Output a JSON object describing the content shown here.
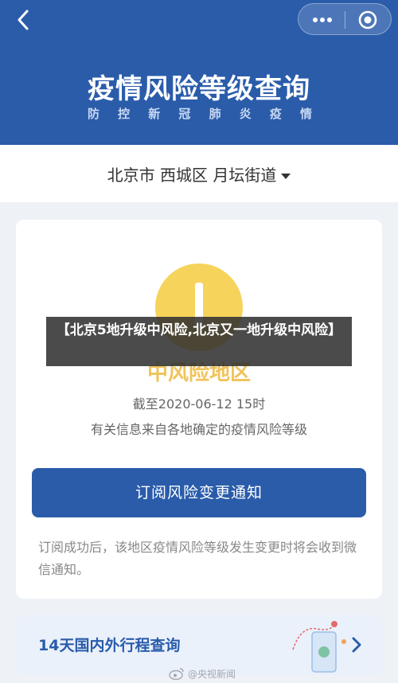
{
  "header": {
    "title": "疫情风险等级查询",
    "subtitle_chars": [
      "防",
      "控",
      "新",
      "冠",
      "肺",
      "炎",
      "疫",
      "情"
    ]
  },
  "location": {
    "text": "北京市 西城区 月坛街道"
  },
  "card": {
    "risk_level": "中风险地区",
    "date": "截至2020-06-12 15时",
    "source": "有关信息来自各地确定的疫情风险等级",
    "subscribe_label": "订阅风险变更通知",
    "note": "订阅成功后，该地区疫情风险等级发生变更时将会收到微信通知。"
  },
  "trip": {
    "label": "14天国内外行程查询"
  },
  "banner": {
    "text": "【北京5地升级中风险,北京又一地升级中风险】"
  },
  "watermark": {
    "text": "@央视新闻"
  },
  "colors": {
    "brand_blue": "#2a5caa",
    "risk_yellow": "#f6d35b"
  },
  "icons": [
    "back-arrow-icon",
    "more-dots-icon",
    "close-target-icon",
    "dropdown-caret-icon",
    "map-route-icon",
    "chevron-right-icon",
    "weibo-icon"
  ]
}
